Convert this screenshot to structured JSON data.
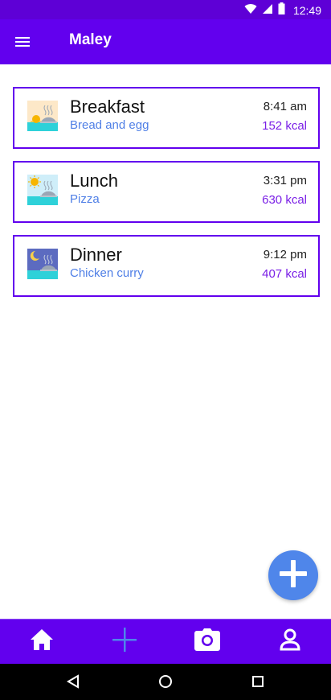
{
  "status_bar": {
    "time": "12:49",
    "icons": [
      "wifi-icon",
      "cellular-signal-icon",
      "battery-icon"
    ]
  },
  "app_bar": {
    "title": "Maley",
    "menu_icon": "hamburger-menu-icon"
  },
  "meals": [
    {
      "name": "Breakfast",
      "description": "Bread and egg",
      "time": "8:41 am",
      "kcal": "152 kcal",
      "icon": "breakfast-icon"
    },
    {
      "name": "Lunch",
      "description": "Pizza",
      "time": "3:31 pm",
      "kcal": "630 kcal",
      "icon": "lunch-icon"
    },
    {
      "name": "Dinner",
      "description": "Chicken curry",
      "time": "9:12 pm",
      "kcal": "407 kcal",
      "icon": "dinner-icon"
    }
  ],
  "fab": {
    "icon": "add-icon"
  },
  "bottom_nav": {
    "items": [
      {
        "icon": "home-icon"
      },
      {
        "icon": "add-icon"
      },
      {
        "icon": "camera-icon"
      },
      {
        "icon": "profile-icon"
      }
    ]
  },
  "system_nav": {
    "icons": [
      "back-icon",
      "home-circle-icon",
      "recents-icon"
    ]
  },
  "colors": {
    "primary": "#6200ee",
    "status_bar": "#5e00d6",
    "accent_blue": "#4f86ea",
    "description_text": "#4f7fe6",
    "kcal_text": "#7a1fe6"
  }
}
